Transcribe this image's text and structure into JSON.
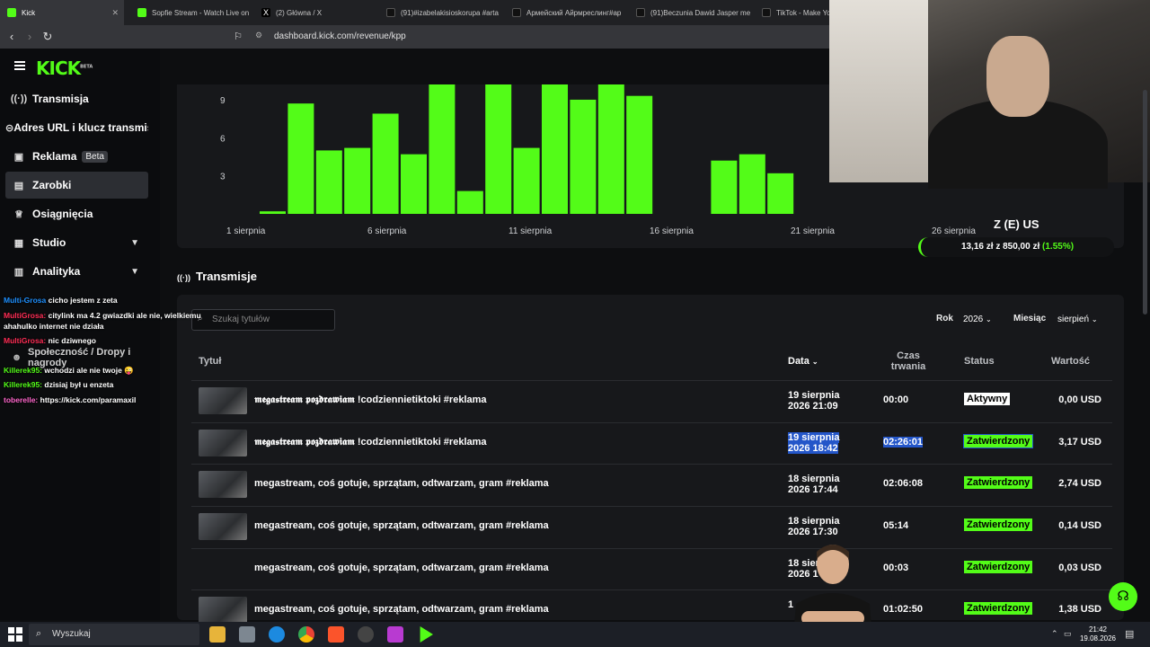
{
  "browser": {
    "tabs": [
      {
        "title": "Kick",
        "color": "#53fc18"
      },
      {
        "title": "Sopfie Stream - Watch Live on",
        "color": "#53fc18"
      },
      {
        "title": "(2) Główna / X",
        "color": "#ffffff"
      },
      {
        "title": "(91)#izabelakisioskorupa #arta",
        "color": "#ffffff"
      },
      {
        "title": "Армейский Айрмреслинг#ар",
        "color": "#ffffff"
      },
      {
        "title": "(91)Beczunia Dawid Jasper me",
        "color": "#ffffff"
      },
      {
        "title": "TikTok - Make Yo",
        "color": "#ffffff"
      }
    ],
    "url": "dashboard.kick.com/revenue/kpp"
  },
  "sidebar": {
    "logo": "KICK",
    "logo_tag": "BETA",
    "items": [
      {
        "label": "Transmisja",
        "icon": "broadcast-icon",
        "glyph": "((·))"
      },
      {
        "label": "Adres URL i klucz transmis",
        "icon": "link-icon",
        "glyph": "⊝"
      },
      {
        "label": "Reklama",
        "icon": "ad-icon",
        "glyph": "▣",
        "badge": "Beta"
      },
      {
        "label": "Zarobki",
        "icon": "wallet-icon",
        "glyph": "▤",
        "selected": true
      },
      {
        "label": "Osiągnięcia",
        "icon": "trophy-icon",
        "glyph": "♕"
      },
      {
        "label": "Studio",
        "icon": "studio-icon",
        "glyph": "▦",
        "chevron": true
      },
      {
        "label": "Analityka",
        "icon": "chart-icon",
        "glyph": "▥",
        "chevron": true
      }
    ]
  },
  "chart_data": {
    "type": "bar",
    "x_tick_labels": [
      "1 sierpnia",
      "6 sierpnia",
      "11 sierpnia",
      "16 sierpnia",
      "21 sierpnia",
      "26 sierpnia"
    ],
    "y_tick_labels": [
      "3",
      "6",
      "9"
    ],
    "ylim": [
      0,
      10.2
    ],
    "bar_color": "#53fc18",
    "values": [
      0.2,
      8.7,
      5.0,
      5.2,
      7.9,
      4.7,
      10.2,
      1.8,
      10.2,
      5.2,
      10.2,
      9.0,
      10.2,
      9.3,
      0,
      0,
      4.2,
      4.7,
      3.2,
      0,
      0,
      0,
      0,
      0,
      0,
      0,
      0,
      0,
      0,
      0,
      0
    ]
  },
  "transmisje": {
    "title": "Transmisje",
    "search_placeholder": "Szukaj tytułów",
    "year_label": "Rok",
    "year_value": "2026",
    "month_label": "Miesiąc",
    "month_value": "sierpień",
    "headers": {
      "title": "Tytuł",
      "date": "Data",
      "duration": "Czas trwania",
      "status": "Status",
      "value": "Wartość"
    },
    "rows": [
      {
        "title": "𝖒𝖊𝖌𝖆𝖘𝖙𝖗𝖊𝖆𝖒 𝖕𝖔𝖟𝖉𝖗𝖆𝖜𝖎𝖆𝖒 !codziennietiktoki #reklama",
        "date1": "19 sierpnia",
        "date2": "2026 21:09",
        "duration": "00:00",
        "status": "Aktywny",
        "value": "0,00 USD"
      },
      {
        "title": "𝖒𝖊𝖌𝖆𝖘𝖙𝖗𝖊𝖆𝖒 𝖕𝖔𝖟𝖉𝖗𝖆𝖜𝖎𝖆𝖒 !codziennietiktoki #reklama",
        "date1": "19 sierpnia",
        "date2": "2026 18:42",
        "duration": "02:26:01",
        "status": "Zatwierdzony",
        "value": "3,17 USD"
      },
      {
        "title": "megastream, coś gotuje, sprzątam, odtwarzam, gram #reklama",
        "date1": "18 sierpnia",
        "date2": "2026 17:44",
        "duration": "02:06:08",
        "status": "Zatwierdzony",
        "value": "2,74 USD"
      },
      {
        "title": "megastream, coś gotuje, sprzątam, odtwarzam, gram #reklama",
        "date1": "18 sierpnia",
        "date2": "2026 17:30",
        "duration": "05:14",
        "status": "Zatwierdzony",
        "value": "0,14 USD"
      },
      {
        "title": "megastream, coś gotuje, sprzątam, odtwarzam, gram #reklama",
        "date1": "18 sierpnia",
        "date2": "2026 1",
        "duration": "00:03",
        "status": "Zatwierdzony",
        "value": "0,03 USD"
      },
      {
        "title": "megastream, coś gotuje, sprzątam, odtwarzam, gram #reklama",
        "date1": "1",
        "date2": "",
        "duration": "01:02:50",
        "status": "Zatwierdzony",
        "value": "1,38 USD"
      }
    ]
  },
  "goal": {
    "title": "Z (E) US",
    "current": "13,16 zł",
    "sep": "z",
    "target": "850,00 zł",
    "percent": "(1.55%)",
    "progress_fraction": 0.0155
  },
  "chat": [
    {
      "user": "Multi-Grosa",
      "text": "cicho jestem z zeta",
      "ucolor": "#1e90ff"
    },
    {
      "user": "MultiGrosa:",
      "text": "citylink ma 4.2 gwiazdki ale nie, wielkiemu",
      "ucolor": "#ff2d55"
    },
    {
      "user": "",
      "text": "ahahulko internet nie działa",
      "ucolor": "#ffffff"
    },
    {
      "user": "MultiGrosa:",
      "text": "nic dziwnego",
      "ucolor": "#ff2d55"
    },
    {
      "user": "",
      "text": "Społeczność / Dropy i nagrody",
      "ucolor": "#ffffff"
    },
    {
      "user": "Killerek95:",
      "text": "wchodzi ale nie twoje 😜",
      "ucolor": "#53fc18"
    },
    {
      "user": "Killerek95:",
      "text": "dzisiaj był u enzeta",
      "ucolor": "#53fc18"
    },
    {
      "user": "toberelle:",
      "text": "https://kick.com/paramaxil",
      "ucolor": "#ff66cc"
    }
  ],
  "taskbar": {
    "search": "Wyszukaj",
    "time": "21:42",
    "date": "19.08.2026"
  }
}
